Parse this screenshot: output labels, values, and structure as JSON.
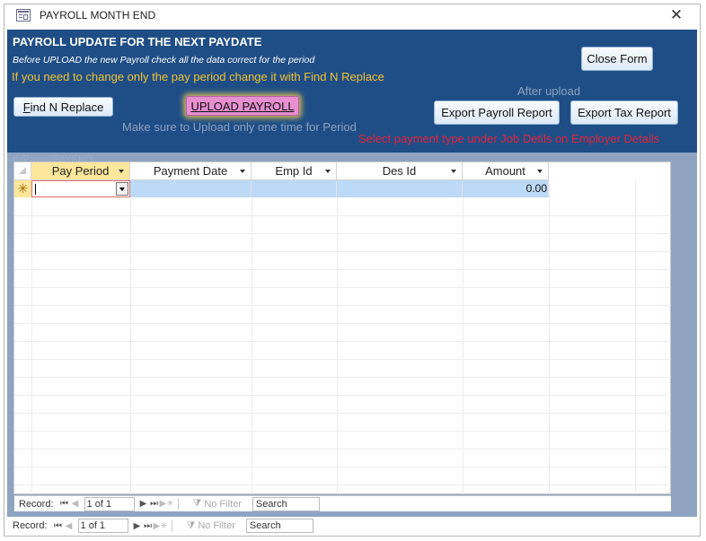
{
  "window": {
    "title": "PAYROLL MONTH END",
    "close_glyph": "✕",
    "icon": "form-icon"
  },
  "header": {
    "title": "PAYROLL UPDATE FOR THE NEXT PAYDATE",
    "instruction": "Before UPLOAD the new Payroll check all the data correct for the period",
    "hint": "If you need to change only the pay period change it with Find N Replace",
    "after_upload": "After upload",
    "make_sure": "Make sure to Upload only one time for Period",
    "select_notice": "Select payment type under Job Detils on Employer Details",
    "colors": {
      "background": "#1f4e86",
      "hint": "#f2c233",
      "notice": "#e2233b",
      "muted": "#8ca2bf"
    }
  },
  "buttons": {
    "find_replace": {
      "accel": "F",
      "rest": "ind N Replace"
    },
    "upload_payroll": {
      "accel": "U",
      "rest": "PLOAD PAYROLL"
    },
    "close_form": "Close Form",
    "export_payroll": "Export Payroll Report",
    "export_tax": "Export Tax Report"
  },
  "subform": {
    "name": "tblPayrollPAYEND"
  },
  "datasheet": {
    "columns": [
      "Pay Period",
      "Payment Date",
      "Emp Id",
      "Des Id",
      "Amount"
    ],
    "new_row": {
      "marker": "✳",
      "pay_period": "",
      "payment_date": "",
      "emp_id": "",
      "des_id": "",
      "amount": "0.00"
    }
  },
  "nav_inner": {
    "label": "Record:",
    "position": "1 of 1",
    "filter": "No Filter",
    "search": "Search"
  },
  "nav_outer": {
    "label": "Record:",
    "position": "1 of 1",
    "filter": "No Filter",
    "search": "Search"
  }
}
